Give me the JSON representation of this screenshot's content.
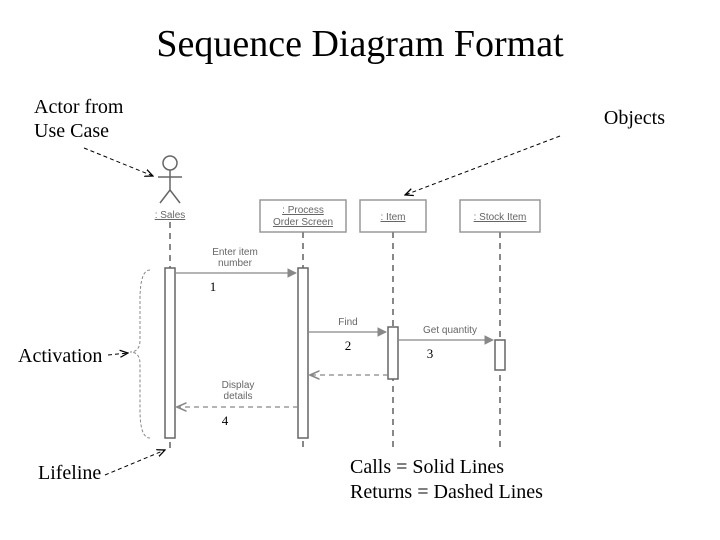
{
  "title": "Sequence Diagram Format",
  "labels": {
    "actor": "Actor from\nUse Case",
    "objects": "Objects",
    "activation": "Activation",
    "lifeline": "Lifeline"
  },
  "legend": {
    "calls": "Calls = Solid Lines",
    "returns": "Returns = Dashed Lines"
  },
  "participants": {
    "actor": ": Sales",
    "p1": ": Process\nOrder Screen",
    "p2": ": Item",
    "p3": ": Stock Item"
  },
  "messages": {
    "m1": "Enter item\nnumber",
    "m2": "Find",
    "m3": "Get quantity",
    "m4": "Display\ndetails"
  },
  "numbers": {
    "n1": "1",
    "n2": "2",
    "n3": "3",
    "n4": "4"
  }
}
